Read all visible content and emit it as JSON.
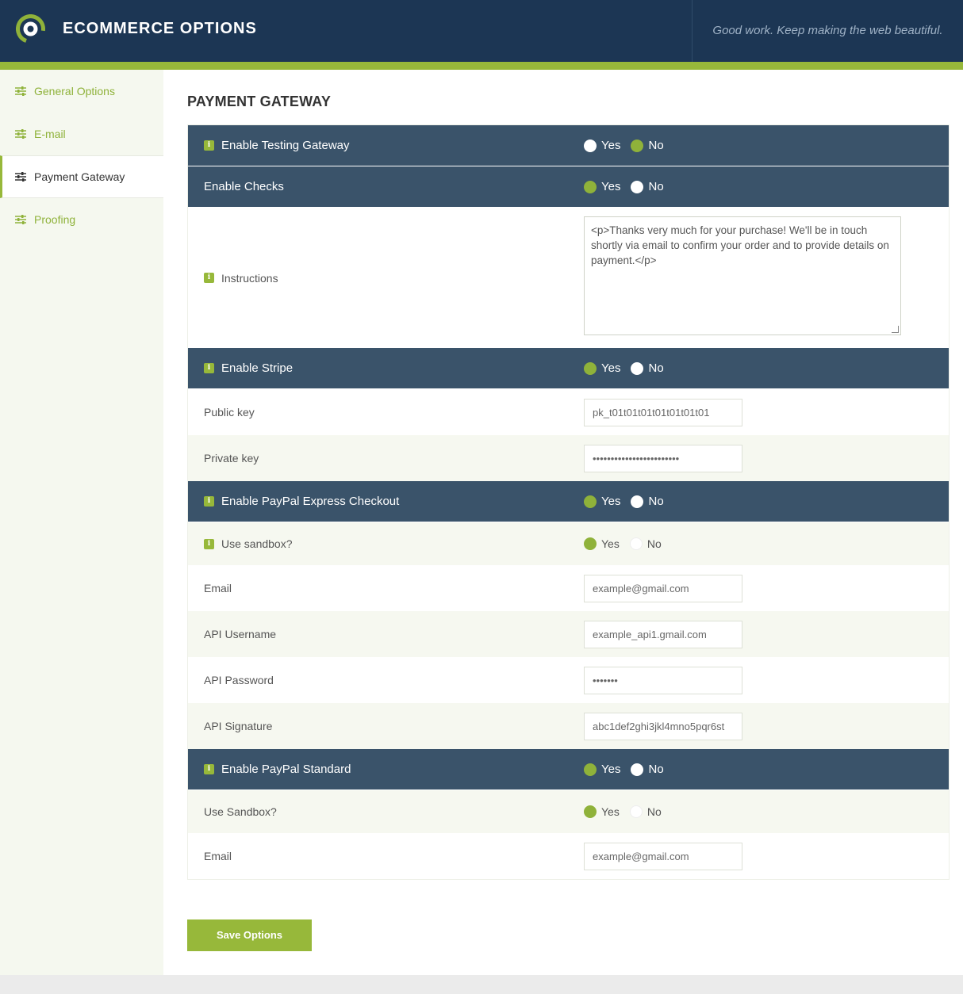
{
  "header": {
    "title": "ECOMMERCE OPTIONS",
    "tagline": "Good work. Keep making the web beautiful."
  },
  "sidebar": {
    "items": [
      {
        "label": "General Options",
        "icon": "sliders-icon",
        "active": false
      },
      {
        "label": "E-mail",
        "icon": "sliders-icon",
        "active": false
      },
      {
        "label": "Payment Gateway",
        "icon": "sliders-icon",
        "active": true
      },
      {
        "label": "Proofing",
        "icon": "sliders-icon",
        "active": false
      }
    ]
  },
  "page": {
    "title": "PAYMENT GATEWAY",
    "yes": "Yes",
    "no": "No",
    "save_label": "Save Options"
  },
  "form": {
    "testing": {
      "label": "Enable Testing Gateway",
      "selected": "No"
    },
    "checks": {
      "label": "Enable Checks",
      "selected": "Yes"
    },
    "instructions": {
      "label": "Instructions",
      "value": "<p>Thanks very much for your purchase! We'll be in touch shortly via email to confirm your order and to provide details on payment.</p>"
    },
    "stripe": {
      "label": "Enable Stripe",
      "selected": "Yes"
    },
    "public_key": {
      "label": "Public key",
      "value": "pk_t01t01t01t01t01t01t01"
    },
    "private_key": {
      "label": "Private key",
      "value": "••••••••••••••••••••••••"
    },
    "paypal_express": {
      "label": "Enable PayPal Express Checkout",
      "selected": "Yes"
    },
    "express_sandbox": {
      "label": "Use sandbox?",
      "selected": "Yes"
    },
    "express_email": {
      "label": "Email",
      "value": "example@gmail.com"
    },
    "api_username": {
      "label": "API Username",
      "value": "example_api1.gmail.com"
    },
    "api_password": {
      "label": "API Password",
      "value": "•••••••"
    },
    "api_signature": {
      "label": "API Signature",
      "value": "abc1def2ghi3jkl4mno5pqr6st"
    },
    "paypal_standard": {
      "label": "Enable PayPal Standard",
      "selected": "Yes"
    },
    "standard_sandbox": {
      "label": "Use Sandbox?",
      "selected": "Yes"
    },
    "standard_email": {
      "label": "Email",
      "value": "example@gmail.com"
    }
  },
  "colors": {
    "topbar": "#1c3654",
    "accent": "#97b83a",
    "header_row": "#3a536a",
    "sidebar_bg": "#f5f8ef"
  }
}
